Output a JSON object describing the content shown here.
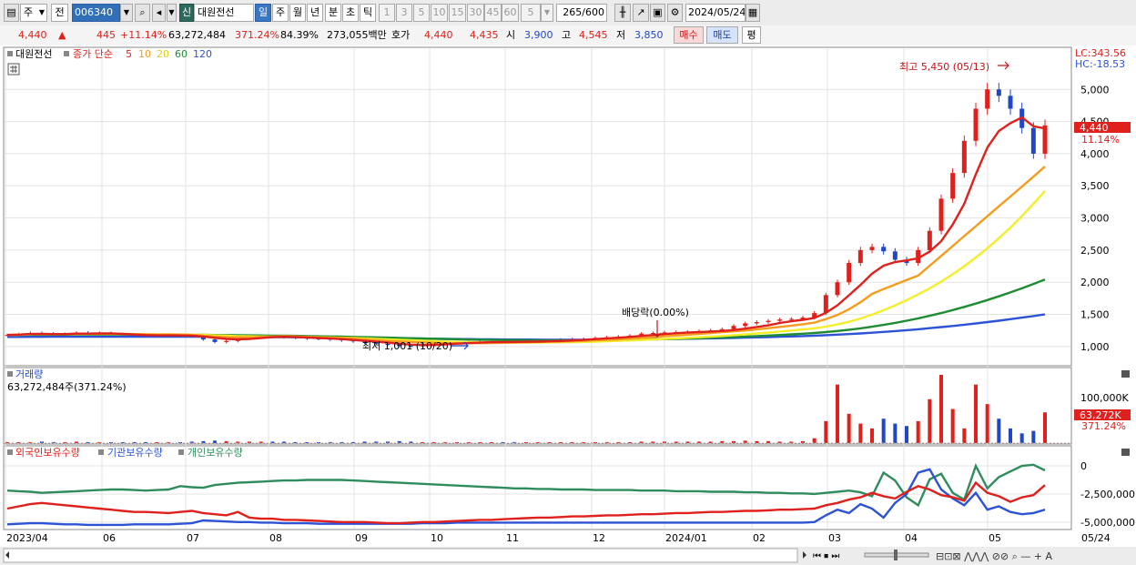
{
  "toolbar": {
    "period": "주",
    "prev": "전",
    "code": "006340",
    "type_badge": "신",
    "stock_name": "대원전선",
    "tabs": [
      "일",
      "주",
      "월",
      "년",
      "분",
      "초",
      "틱"
    ],
    "intervals": [
      "1",
      "3",
      "5",
      "10",
      "15",
      "30",
      "45",
      "60"
    ],
    "interval_value": "5",
    "count_display": "265",
    "count_total": "/600",
    "date": "2024/05/24"
  },
  "quote": {
    "price": "4,440",
    "up_arrow": "▲",
    "change": "445",
    "change_pct": "+11.14%",
    "volume": "63,272,484",
    "volume_ratio": "371.24%",
    "turnover": "84.39%",
    "amount": "273,055백만",
    "ask_label": "호가",
    "ask1": "4,440",
    "ask2": "4,435",
    "open_label": "시",
    "open": "3,900",
    "high_label": "고",
    "high": "4,545",
    "low_label": "저",
    "low": "3,850",
    "buy_label": "매수",
    "sell_label": "매도",
    "eval_label": "평"
  },
  "colors": {
    "up": "#e0201c",
    "down": "#1f47c6",
    "ma5": "#e0201c",
    "ma10": "#f39c1e",
    "ma20": "#f3ee2a",
    "ma60": "#1e8c32",
    "ma120": "#2c53d6",
    "foreign": "#e0201c",
    "institution": "#2c53d6",
    "individual": "#2f8c5c"
  },
  "chart_data": [
    {
      "type": "line",
      "title": "대원전선",
      "legend": {
        "label": "종가 단순",
        "ma": [
          "5",
          "10",
          "20",
          "60",
          "120"
        ]
      },
      "x_ticks": [
        "2023/04",
        "06",
        "07",
        "08",
        "09",
        "10",
        "11",
        "12",
        "2024/01",
        "02",
        "03",
        "04",
        "05",
        "05/24"
      ],
      "y_ticks": [
        1000,
        1500,
        2000,
        2500,
        3000,
        3500,
        4000,
        4500,
        5000
      ],
      "y_tick_labels": [
        "1,000",
        "1,500",
        "2,000",
        "2,500",
        "3,000",
        "3,500",
        "4,000",
        "4,500",
        "5,000"
      ],
      "ylim": [
        800,
        5400
      ],
      "lc_label": "LC:343.56",
      "hc_label": "HC:-18.53",
      "price_tag": "4,440",
      "price_tag_pct": "11.14%",
      "annotations": {
        "high": "최고 5,450 (05/13)",
        "low": "최저 1,001 (10/20)",
        "dividend": "배당락(0.00%)"
      },
      "close": [
        1180,
        1190,
        1210,
        1200,
        1185,
        1195,
        1215,
        1205,
        1210,
        1190,
        1185,
        1175,
        1160,
        1170,
        1180,
        1175,
        1160,
        1110,
        1070,
        1085,
        1120,
        1150,
        1160,
        1150,
        1145,
        1135,
        1125,
        1120,
        1110,
        1095,
        1080,
        1060,
        1040,
        1030,
        1010,
        1005,
        1030,
        1045,
        1055,
        1060,
        1070,
        1075,
        1080,
        1070,
        1065,
        1075,
        1090,
        1100,
        1110,
        1115,
        1120,
        1135,
        1145,
        1155,
        1170,
        1200,
        1210,
        1220,
        1225,
        1230,
        1240,
        1250,
        1270,
        1320,
        1360,
        1380,
        1400,
        1420,
        1430,
        1450,
        1520,
        1800,
        2000,
        2300,
        2500,
        2550,
        2480,
        2350,
        2300,
        2500,
        2800,
        3300,
        3700,
        4200,
        4700,
        5000,
        4900,
        4700,
        4400,
        4000,
        4440
      ],
      "ma": {
        "5": [
          1180,
          1185,
          1195,
          1198,
          1194,
          1194,
          1200,
          1201,
          1203,
          1203,
          1196,
          1187,
          1178,
          1173,
          1173,
          1172,
          1169,
          1155,
          1135,
          1118,
          1112,
          1117,
          1131,
          1145,
          1151,
          1148,
          1141,
          1133,
          1124,
          1115,
          1102,
          1089,
          1075,
          1061,
          1044,
          1029,
          1023,
          1024,
          1033,
          1045,
          1054,
          1061,
          1068,
          1071,
          1072,
          1073,
          1076,
          1080,
          1086,
          1094,
          1103,
          1116,
          1127,
          1137,
          1149,
          1165,
          1180,
          1193,
          1206,
          1217,
          1225,
          1233,
          1241,
          1256,
          1278,
          1304,
          1330,
          1366,
          1393,
          1416,
          1444,
          1524,
          1641,
          1798,
          1958,
          2134,
          2258,
          2315,
          2340,
          2373,
          2477,
          2639,
          2899,
          3219,
          3679,
          4095,
          4353,
          4475,
          4565,
          4426,
          4392
        ],
        "10": [
          1180,
          1185,
          1193,
          1195,
          1191,
          1192,
          1197,
          1198,
          1200,
          1199,
          1195,
          1194,
          1190,
          1187,
          1188,
          1187,
          1182,
          1169,
          1154,
          1146,
          1144,
          1144,
          1149,
          1154,
          1161,
          1158,
          1150,
          1141,
          1135,
          1131,
          1124,
          1113,
          1101,
          1088,
          1080,
          1072,
          1064,
          1057,
          1052,
          1051,
          1050,
          1052,
          1055,
          1058,
          1062,
          1066,
          1070,
          1074,
          1078,
          1082,
          1088,
          1096,
          1103,
          1111,
          1121,
          1134,
          1147,
          1159,
          1171,
          1183,
          1197,
          1211,
          1223,
          1236,
          1249,
          1265,
          1285,
          1305,
          1325,
          1347,
          1372,
          1427,
          1491,
          1580,
          1689,
          1817,
          1894,
          1965,
          2034,
          2103,
          2256,
          2410,
          2564,
          2718,
          2872,
          3026,
          3180,
          3334,
          3488,
          3642,
          3800
        ],
        "20": [
          1180,
          1184,
          1190,
          1193,
          1192,
          1192,
          1194,
          1195,
          1196,
          1196,
          1195,
          1194,
          1192,
          1190,
          1189,
          1188,
          1186,
          1181,
          1174,
          1168,
          1163,
          1159,
          1157,
          1155,
          1153,
          1151,
          1148,
          1145,
          1141,
          1137,
          1132,
          1126,
          1119,
          1112,
          1104,
          1097,
          1090,
          1083,
          1077,
          1072,
          1067,
          1064,
          1062,
          1061,
          1060,
          1061,
          1062,
          1064,
          1066,
          1069,
          1072,
          1076,
          1081,
          1087,
          1094,
          1101,
          1109,
          1117,
          1126,
          1135,
          1144,
          1154,
          1164,
          1176,
          1189,
          1203,
          1218,
          1233,
          1249,
          1265,
          1282,
          1310,
          1343,
          1385,
          1436,
          1496,
          1564,
          1640,
          1722,
          1810,
          1905,
          2010,
          2125,
          2250,
          2385,
          2530,
          2685,
          2850,
          3030,
          3220,
          3420
        ],
        "60": [
          1180,
          1181,
          1183,
          1184,
          1185,
          1185,
          1186,
          1186,
          1187,
          1187,
          1187,
          1187,
          1187,
          1186,
          1186,
          1185,
          1184,
          1182,
          1180,
          1178,
          1176,
          1174,
          1172,
          1170,
          1168,
          1166,
          1163,
          1160,
          1157,
          1154,
          1150,
          1146,
          1142,
          1138,
          1133,
          1129,
          1125,
          1121,
          1117,
          1113,
          1109,
          1106,
          1103,
          1100,
          1098,
          1096,
          1095,
          1094,
          1094,
          1094,
          1095,
          1096,
          1098,
          1100,
          1103,
          1106,
          1110,
          1114,
          1119,
          1124,
          1129,
          1135,
          1141,
          1148,
          1155,
          1163,
          1171,
          1180,
          1189,
          1199,
          1210,
          1225,
          1242,
          1261,
          1283,
          1308,
          1336,
          1367,
          1401,
          1438,
          1478,
          1521,
          1567,
          1616,
          1668,
          1723,
          1781,
          1842,
          1906,
          1973,
          2043
        ],
        "120": [
          1150,
          1150,
          1151,
          1151,
          1152,
          1152,
          1153,
          1153,
          1154,
          1154,
          1154,
          1154,
          1154,
          1154,
          1154,
          1153,
          1153,
          1152,
          1151,
          1150,
          1149,
          1148,
          1147,
          1146,
          1145,
          1144,
          1142,
          1141,
          1139,
          1137,
          1135,
          1133,
          1131,
          1129,
          1127,
          1125,
          1123,
          1121,
          1119,
          1117,
          1115,
          1113,
          1111,
          1110,
          1109,
          1108,
          1107,
          1106,
          1106,
          1106,
          1106,
          1107,
          1108,
          1109,
          1110,
          1112,
          1114,
          1116,
          1118,
          1121,
          1124,
          1127,
          1130,
          1134,
          1138,
          1142,
          1147,
          1152,
          1157,
          1163,
          1170,
          1177,
          1185,
          1194,
          1204,
          1215,
          1227,
          1240,
          1254,
          1269,
          1285,
          1302,
          1320,
          1339,
          1359,
          1380,
          1402,
          1425,
          1449,
          1474,
          1500
        ]
      },
      "volume_spikes_index": [
        71,
        72,
        73,
        76,
        79,
        81,
        82,
        83,
        84,
        86,
        87,
        90
      ]
    },
    {
      "type": "bar",
      "title": "거래량",
      "value_label": "63,272,484주(371.24%)",
      "y_tick_labels": [
        "100,000K"
      ],
      "tag": "63,272K",
      "tag_pct": "371.24%",
      "values": [
        2,
        2,
        2,
        3,
        2,
        2,
        3,
        2,
        2,
        2,
        2,
        2,
        2,
        2,
        2,
        2,
        3,
        4,
        5,
        4,
        3,
        3,
        3,
        3,
        3,
        2,
        2,
        2,
        2,
        2,
        2,
        3,
        3,
        3,
        4,
        3,
        2,
        2,
        2,
        2,
        2,
        2,
        2,
        2,
        2,
        2,
        2,
        2,
        2,
        2,
        2,
        2,
        2,
        2,
        2,
        3,
        3,
        3,
        3,
        3,
        3,
        3,
        4,
        4,
        5,
        4,
        4,
        3,
        3,
        4,
        10,
        45,
        120,
        60,
        40,
        30,
        50,
        40,
        35,
        45,
        90,
        140,
        70,
        30,
        120,
        80,
        50,
        30,
        20,
        25,
        63
      ]
    },
    {
      "type": "line",
      "title": "외국인보유수량",
      "legend": [
        "외국인보유수량",
        "기관보유수량",
        "개인보유수량"
      ],
      "y_ticks": [
        0,
        -2500000,
        -5000000
      ],
      "y_tick_labels": [
        "0",
        "-2,500,000",
        "-5,000,000"
      ],
      "ylim": [
        -5500000,
        1300000
      ],
      "series": [
        {
          "name": "외국인보유수량",
          "values": [
            -3800000,
            -3600000,
            -3400000,
            -3300000,
            -3400000,
            -3500000,
            -3600000,
            -3700000,
            -3800000,
            -3900000,
            -4000000,
            -4100000,
            -4100000,
            -4150000,
            -4200000,
            -4100000,
            -4000000,
            -4200000,
            -4300000,
            -4400000,
            -4100000,
            -4600000,
            -4700000,
            -4700000,
            -4800000,
            -4800000,
            -4850000,
            -4900000,
            -4950000,
            -5000000,
            -5000000,
            -5000000,
            -5050000,
            -5100000,
            -5100000,
            -5050000,
            -5000000,
            -5000000,
            -4950000,
            -4900000,
            -4850000,
            -4800000,
            -4800000,
            -4750000,
            -4700000,
            -4650000,
            -4600000,
            -4600000,
            -4550000,
            -4500000,
            -4500000,
            -4450000,
            -4400000,
            -4400000,
            -4350000,
            -4300000,
            -4300000,
            -4250000,
            -4200000,
            -4200000,
            -4150000,
            -4100000,
            -4100000,
            -4050000,
            -4000000,
            -4000000,
            -3950000,
            -3900000,
            -3900000,
            -3850000,
            -3800000,
            -3500000,
            -3300000,
            -3000000,
            -2800000,
            -2400000,
            -2700000,
            -2900000,
            -2300000,
            -1800000,
            -2100000,
            -2600000,
            -2800000,
            -3100000,
            -1500000,
            -2400000,
            -2700000,
            -3200000,
            -2800000,
            -2600000,
            -1700000
          ]
        },
        {
          "name": "기관보유수량",
          "values": [
            -5200000,
            -5150000,
            -5100000,
            -5100000,
            -5150000,
            -5200000,
            -5200000,
            -5250000,
            -5250000,
            -5250000,
            -5250000,
            -5200000,
            -5200000,
            -5200000,
            -5200000,
            -5150000,
            -5100000,
            -4850000,
            -4900000,
            -4950000,
            -5000000,
            -5000000,
            -5050000,
            -5050000,
            -5100000,
            -5100000,
            -5100000,
            -5150000,
            -5150000,
            -5150000,
            -5150000,
            -5150000,
            -5150000,
            -5150000,
            -5150000,
            -5150000,
            -5100000,
            -5100000,
            -5100000,
            -5050000,
            -5050000,
            -5050000,
            -5050000,
            -5050000,
            -5050000,
            -5050000,
            -5050000,
            -5050000,
            -5050000,
            -5050000,
            -5050000,
            -5050000,
            -5050000,
            -5050000,
            -5050000,
            -5050000,
            -5050000,
            -5050000,
            -5050000,
            -5050000,
            -5050000,
            -5050000,
            -5050000,
            -5050000,
            -5050000,
            -5050000,
            -5050000,
            -5050000,
            -5050000,
            -5050000,
            -5000000,
            -4400000,
            -3900000,
            -4200000,
            -3400000,
            -3800000,
            -4600000,
            -3300000,
            -2500000,
            -600000,
            -300000,
            -2100000,
            -2900000,
            -3500000,
            -2400000,
            -3900000,
            -3600000,
            -4100000,
            -4300000,
            -4200000,
            -3900000
          ]
        },
        {
          "name": "개인보유수량",
          "values": [
            -2200000,
            -2250000,
            -2300000,
            -2400000,
            -2350000,
            -2300000,
            -2250000,
            -2200000,
            -2150000,
            -2100000,
            -2100000,
            -2150000,
            -2200000,
            -2150000,
            -2100000,
            -1800000,
            -1900000,
            -1950000,
            -1700000,
            -1600000,
            -1500000,
            -1450000,
            -1400000,
            -1350000,
            -1300000,
            -1300000,
            -1250000,
            -1250000,
            -1250000,
            -1250000,
            -1300000,
            -1350000,
            -1400000,
            -1450000,
            -1500000,
            -1550000,
            -1600000,
            -1650000,
            -1700000,
            -1750000,
            -1800000,
            -1850000,
            -1900000,
            -1950000,
            -2000000,
            -2000000,
            -2050000,
            -2050000,
            -2100000,
            -2100000,
            -2100000,
            -2150000,
            -2150000,
            -2150000,
            -2150000,
            -2200000,
            -2200000,
            -2200000,
            -2250000,
            -2250000,
            -2250000,
            -2300000,
            -2300000,
            -2300000,
            -2350000,
            -2350000,
            -2400000,
            -2400000,
            -2450000,
            -2450000,
            -2500000,
            -2400000,
            -2300000,
            -2200000,
            -2350000,
            -2700000,
            -600000,
            -1300000,
            -2800000,
            -3500000,
            -1200000,
            -700000,
            -2400000,
            -3000000,
            0,
            -2000000,
            -1000000,
            -500000,
            0,
            100000,
            -400000
          ]
        }
      ]
    }
  ]
}
